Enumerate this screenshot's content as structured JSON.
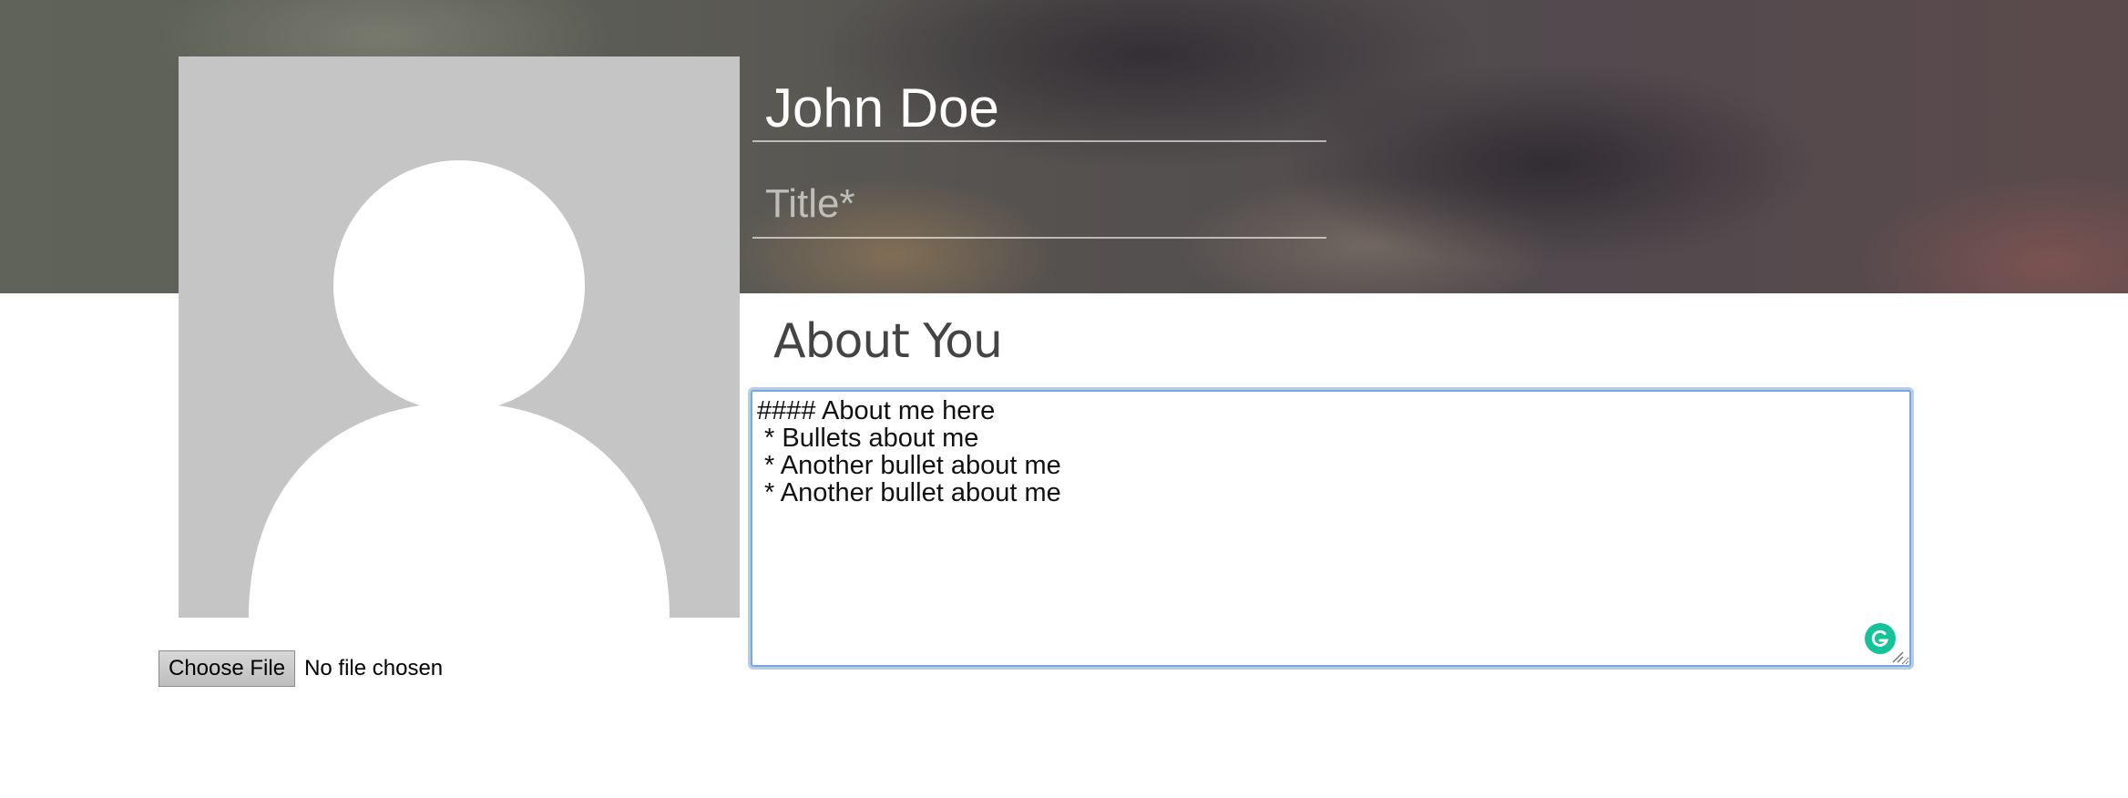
{
  "profile": {
    "name_value": "John Doe",
    "title_placeholder": "Title*"
  },
  "about": {
    "heading": "About You",
    "textarea_value": "#### About me here\n * Bullets about me\n * Another bullet about me\n * Another bullet about me "
  },
  "upload": {
    "button_label": "Choose File",
    "status_text": "No file chosen"
  },
  "icons": {
    "avatar": "user-silhouette-icon",
    "grammar": "grammarly-icon",
    "resize": "resize-grip-icon"
  },
  "colors": {
    "avatar_bg": "#c5c5c5",
    "focus_ring": "#7aa6d8",
    "grammar_badge": "#15c39a"
  }
}
